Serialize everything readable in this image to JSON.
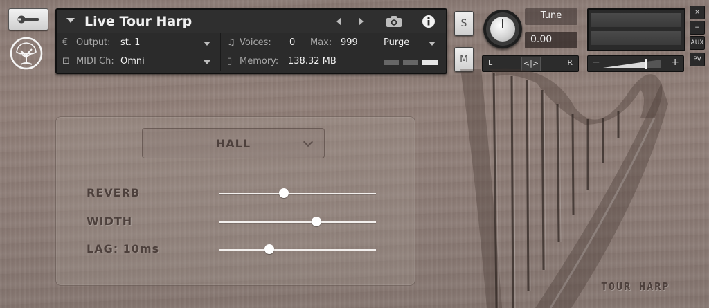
{
  "header": {
    "title": "Live Tour Harp",
    "output_label": "Output:",
    "output_value": "st. 1",
    "voices_label": "Voices:",
    "voices_value": "0",
    "max_label": "Max:",
    "max_value": "999",
    "purge_label": "Purge",
    "midi_label": "MIDI Ch:",
    "midi_value": "Omni",
    "memory_label": "Memory:",
    "memory_value": "138.32 MB"
  },
  "solo_label": "S",
  "mute_label": "M",
  "tune": {
    "label": "Tune",
    "value": "0.00"
  },
  "pan": {
    "left": "L",
    "right": "R",
    "center": "<|>"
  },
  "volume": {
    "minus": "−",
    "plus": "+"
  },
  "side_buttons": {
    "close": "×",
    "minimize": "−",
    "aux": "AUX",
    "pv": "PV"
  },
  "brand": "TOUR HARP",
  "fx": {
    "mode": "HALL",
    "sliders": [
      {
        "label": "REVERB",
        "value": 0.41
      },
      {
        "label": "WIDTH",
        "value": 0.62
      },
      {
        "label": "LAG: 10ms",
        "value": 0.32
      }
    ]
  }
}
